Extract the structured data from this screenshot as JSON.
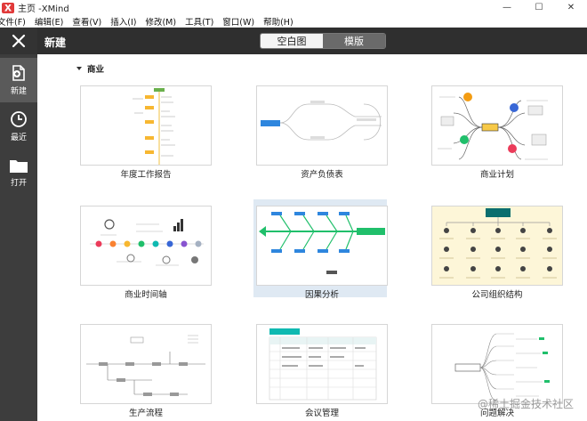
{
  "window": {
    "title": "主页 -XMind",
    "minimize": "—",
    "maximize": "☐",
    "close": "✕"
  },
  "menu": [
    "文件(F)",
    "编辑(E)",
    "查看(V)",
    "插入(I)",
    "修改(M)",
    "工具(T)",
    "窗口(W)",
    "帮助(H)"
  ],
  "sidebar": {
    "items": [
      {
        "label": "新建",
        "icon": "new-file-icon"
      },
      {
        "label": "最近",
        "icon": "clock-icon"
      },
      {
        "label": "打开",
        "icon": "folder-icon"
      }
    ]
  },
  "header": {
    "title": "新建",
    "blank_label": "空白图",
    "template_label": "模版"
  },
  "section": {
    "title": "商业"
  },
  "templates": [
    {
      "name": "年度工作报告"
    },
    {
      "name": "资产负债表"
    },
    {
      "name": "商业计划"
    },
    {
      "name": "商业时间轴"
    },
    {
      "name": "因果分析"
    },
    {
      "name": "公司组织结构"
    },
    {
      "name": "生产流程"
    },
    {
      "name": "会议管理"
    },
    {
      "name": "问题解决"
    }
  ],
  "selected_template": "因果分析",
  "watermark": "@稀土掘金技术社区",
  "colors": {
    "sidebar": "#3d3d3d",
    "header": "#2f2f2f",
    "selected": "#dfe9f3",
    "accent_red": "#e13a3a"
  }
}
